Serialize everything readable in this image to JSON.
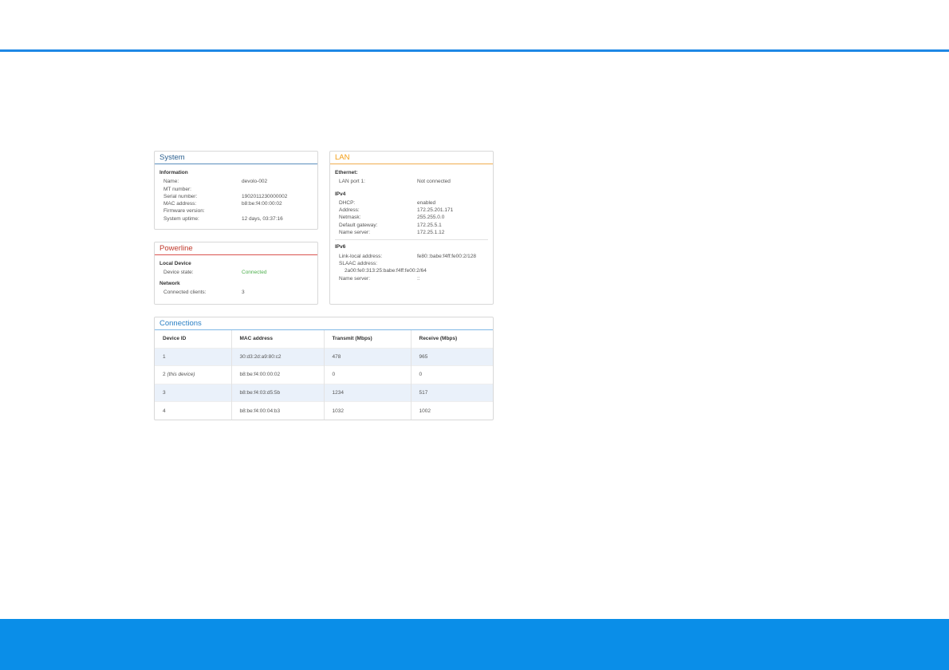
{
  "system": {
    "title": "System",
    "section": "Information",
    "rows": [
      {
        "k": "Name:",
        "v": "devolo-002"
      },
      {
        "k": "MT number:",
        "v": ""
      },
      {
        "k": "Serial number:",
        "v": "1902011230000002"
      },
      {
        "k": "MAC address:",
        "v": "b8:be:f4:00:00:02"
      },
      {
        "k": "Firmware version:",
        "v": ""
      },
      {
        "k": "System uptime:",
        "v": "12 days, 03:37:16"
      }
    ]
  },
  "powerline": {
    "title": "Powerline",
    "local_section": "Local Device",
    "device_state_label": "Device state:",
    "device_state_value": "Connected",
    "network_section": "Network",
    "clients_label": "Connected clients:",
    "clients_value": "3"
  },
  "lan": {
    "title": "LAN",
    "ethernet_section": "Ethernet:",
    "lan_port_label": "LAN port 1:",
    "lan_port_value": "Not connected",
    "ipv4_section": "IPv4",
    "ipv4_rows": [
      {
        "k": "DHCP:",
        "v": "enabled"
      },
      {
        "k": "Address:",
        "v": "172.25.201.171"
      },
      {
        "k": "Netmask:",
        "v": "255.255.0.0"
      },
      {
        "k": "Default gateway:",
        "v": "172.25.5.1"
      },
      {
        "k": "Name server:",
        "v": "172.25.1.12"
      }
    ],
    "ipv6_section": "IPv6",
    "link_local_label": "Link-local address:",
    "link_local_value": "fe80::babe:f4ff:fe00:2/128",
    "slaac_label": "SLAAC address:",
    "slaac_value": "2a00:fe0:313:25:babe:f4ff:fe00:2/64",
    "ipv6_ns_label": "Name server:",
    "ipv6_ns_value": "::"
  },
  "connections": {
    "title": "Connections",
    "headers": [
      "Device ID",
      "MAC address",
      "Transmit (Mbps)",
      "Receive (Mbps)"
    ],
    "rows": [
      {
        "id": "1",
        "note": "",
        "mac": "30:d3:2d:a9:80:c2",
        "tx": "478",
        "rx": "965"
      },
      {
        "id": "2",
        "note": "(this device)",
        "mac": "b8:be:f4:00:00:02",
        "tx": "0",
        "rx": "0"
      },
      {
        "id": "3",
        "note": "",
        "mac": "b8:be:f4:03:d5:5b",
        "tx": "1234",
        "rx": "517"
      },
      {
        "id": "4",
        "note": "",
        "mac": "b8:be:f4:00:04:b3",
        "tx": "1032",
        "rx": "1002"
      }
    ]
  },
  "colors": {
    "accent_blue": "#1e88e5",
    "footer_blue": "#0a8ee8",
    "system_title": "#2a5f8f",
    "powerline_title": "#c0392b",
    "lan_title": "#f39c12",
    "connected_green": "#4cae4c"
  }
}
